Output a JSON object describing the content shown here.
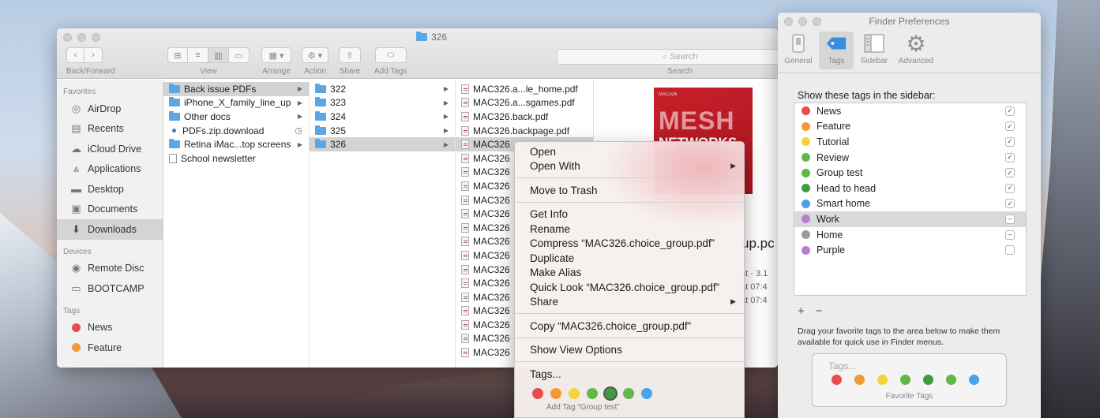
{
  "finder": {
    "title": "326",
    "toolbar": {
      "back_forward_label": "Back/Forward",
      "view_label": "View",
      "arrange_label": "Arrange",
      "action_label": "Action",
      "share_label": "Share",
      "add_tags_label": "Add Tags",
      "search_placeholder": "Search",
      "search_label": "Search"
    },
    "sidebar": {
      "favorites_header": "Favorites",
      "favorites": [
        {
          "label": "AirDrop",
          "icon": "airdrop-icon"
        },
        {
          "label": "Recents",
          "icon": "recents-icon"
        },
        {
          "label": "iCloud Drive",
          "icon": "cloud-icon"
        },
        {
          "label": "Applications",
          "icon": "applications-icon"
        },
        {
          "label": "Desktop",
          "icon": "desktop-icon"
        },
        {
          "label": "Documents",
          "icon": "documents-icon"
        },
        {
          "label": "Downloads",
          "icon": "downloads-icon",
          "selected": true
        }
      ],
      "devices_header": "Devices",
      "devices": [
        {
          "label": "Remote Disc",
          "icon": "disc-icon"
        },
        {
          "label": "BOOTCAMP",
          "icon": "drive-icon"
        }
      ],
      "tags_header": "Tags",
      "tags": [
        {
          "label": "News",
          "color": "#e84c4c"
        },
        {
          "label": "Feature",
          "color": "#f29a38"
        }
      ]
    },
    "column1": [
      {
        "label": "Back issue PDFs",
        "type": "folder",
        "selected": true,
        "has_arrow": true
      },
      {
        "label": "iPhone_X_family_line_up",
        "type": "folder",
        "has_arrow": true
      },
      {
        "label": "Other docs",
        "type": "folder",
        "has_arrow": true
      },
      {
        "label": "PDFs.zip.download",
        "type": "download"
      },
      {
        "label": "Retina iMac...top screens",
        "type": "folder",
        "has_arrow": true
      },
      {
        "label": "School newsletter",
        "type": "doc"
      }
    ],
    "column2": [
      {
        "label": "322"
      },
      {
        "label": "323"
      },
      {
        "label": "324"
      },
      {
        "label": "325"
      },
      {
        "label": "326",
        "selected": true
      }
    ],
    "column3": [
      "MAC326.a...le_home.pdf",
      "MAC326.a...sgames.pdf",
      "MAC326.back.pdf",
      "MAC326.backpage.pdf",
      "MAC326",
      "MAC326",
      "MAC326",
      "MAC326",
      "MAC326",
      "MAC326",
      "MAC326",
      "MAC326",
      "MAC326",
      "MAC326",
      "MAC326",
      "MAC326",
      "MAC326",
      "MAC326",
      "MAC326",
      "MAC326"
    ],
    "preview": {
      "cover_small": "MAC326",
      "cover_big1": "MESH",
      "cover_big2": "NETWORKS",
      "name": "up.pc",
      "meta1": "nt - 3.1",
      "meta2": "at 07:4",
      "meta3": "at 07:4"
    }
  },
  "context_menu": {
    "items": [
      {
        "label": "Open"
      },
      {
        "label": "Open With",
        "submenu": true
      },
      {
        "sep": true
      },
      {
        "label": "Move to Trash"
      },
      {
        "sep": true
      },
      {
        "label": "Get Info"
      },
      {
        "label": "Rename"
      },
      {
        "label": "Compress “MAC326.choice_group.pdf”"
      },
      {
        "label": "Duplicate"
      },
      {
        "label": "Make Alias"
      },
      {
        "label": "Quick Look “MAC326.choice_group.pdf”"
      },
      {
        "label": "Share",
        "submenu": true
      },
      {
        "sep": true
      },
      {
        "label": "Copy “MAC326.choice_group.pdf”"
      },
      {
        "sep": true
      },
      {
        "label": "Show View Options"
      },
      {
        "sep": true
      },
      {
        "label": "Tags..."
      }
    ],
    "tag_colors": [
      "#e84c4c",
      "#f29a38",
      "#f5d33a",
      "#62b84a",
      "#3f9b3f",
      "#5fb848",
      "#4aa3e8"
    ],
    "highlighted_tag_index": 4,
    "add_tag_text": "Add Tag “Group test”"
  },
  "prefs": {
    "title": "Finder Preferences",
    "tabs": [
      {
        "label": "General",
        "icon": "general-icon"
      },
      {
        "label": "Tags",
        "icon": "tag-icon",
        "selected": true
      },
      {
        "label": "Sidebar",
        "icon": "sidebar-icon"
      },
      {
        "label": "Advanced",
        "icon": "gear-icon"
      }
    ],
    "heading": "Show these tags in the sidebar:",
    "tags": [
      {
        "label": "News",
        "color": "#e84c4c",
        "check": "✓"
      },
      {
        "label": "Feature",
        "color": "#f29a38",
        "check": "✓"
      },
      {
        "label": "Tutorial",
        "color": "#f5d33a",
        "check": "✓"
      },
      {
        "label": "Review",
        "color": "#62b84a",
        "check": "✓"
      },
      {
        "label": "Group test",
        "color": "#5fb848",
        "check": "✓"
      },
      {
        "label": "Head to head",
        "color": "#3f9b3f",
        "check": "✓"
      },
      {
        "label": "Smart home",
        "color": "#4aa3e8",
        "check": "✓"
      },
      {
        "label": "Work",
        "color": "#b67fd0",
        "check": "–",
        "selected": true
      },
      {
        "label": "Home",
        "color": "#9a9a9a",
        "check": "–"
      },
      {
        "label": "Purple",
        "color": "#b67fd0",
        "check": ""
      }
    ],
    "plus": "+",
    "minus": "−",
    "note": "Drag your favorite tags to the area below to make them available for quick use in Finder menus.",
    "fav_placeholder": "Tags...",
    "fav_colors": [
      "#e84c4c",
      "#f29a38",
      "#f5d33a",
      "#62b84a",
      "#3f9b3f",
      "#5fb848",
      "#4aa3e8"
    ],
    "fav_label": "Favorite Tags"
  }
}
